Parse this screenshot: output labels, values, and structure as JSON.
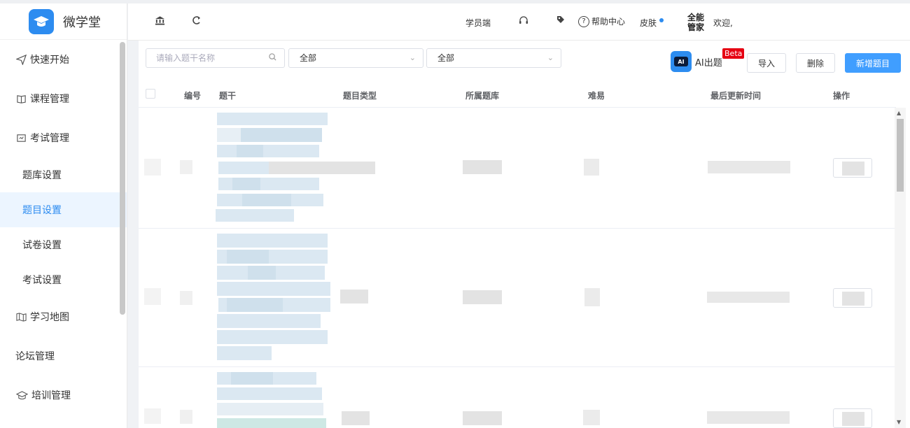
{
  "app": {
    "name": "微学堂"
  },
  "sidebar": {
    "items": [
      {
        "label": "快速开始",
        "icon": "send-icon"
      },
      {
        "label": "课程管理",
        "icon": "book-icon"
      },
      {
        "label": "考试管理",
        "icon": "exam-icon"
      },
      {
        "label": "题库设置",
        "sub": true
      },
      {
        "label": "题目设置",
        "sub": true,
        "active": true
      },
      {
        "label": "试卷设置",
        "sub": true
      },
      {
        "label": "考试设置",
        "sub": true
      },
      {
        "label": "学习地图",
        "icon": "map-icon"
      },
      {
        "label": "论坛管理"
      },
      {
        "label": "培训管理",
        "icon": "grad-icon"
      }
    ]
  },
  "header": {
    "student_end": "学员端",
    "help_center": "帮助中心",
    "skin": "皮肤",
    "brand": "全能管家",
    "welcome": "欢迎,"
  },
  "toolbar": {
    "search_placeholder": "请输入题干名称",
    "select1": "全部",
    "select2": "全部",
    "ai_label": "AI出题",
    "beta": "Beta",
    "import": "导入",
    "delete": "删除",
    "new": "新增题目"
  },
  "table": {
    "columns": [
      "编号",
      "题干",
      "题目类型",
      "所属题库",
      "难易",
      "最后更新时间",
      "操作"
    ]
  },
  "colors": {
    "accent": "#2d8cf0",
    "primary_button": "#409eff",
    "beta": "#e60012"
  }
}
